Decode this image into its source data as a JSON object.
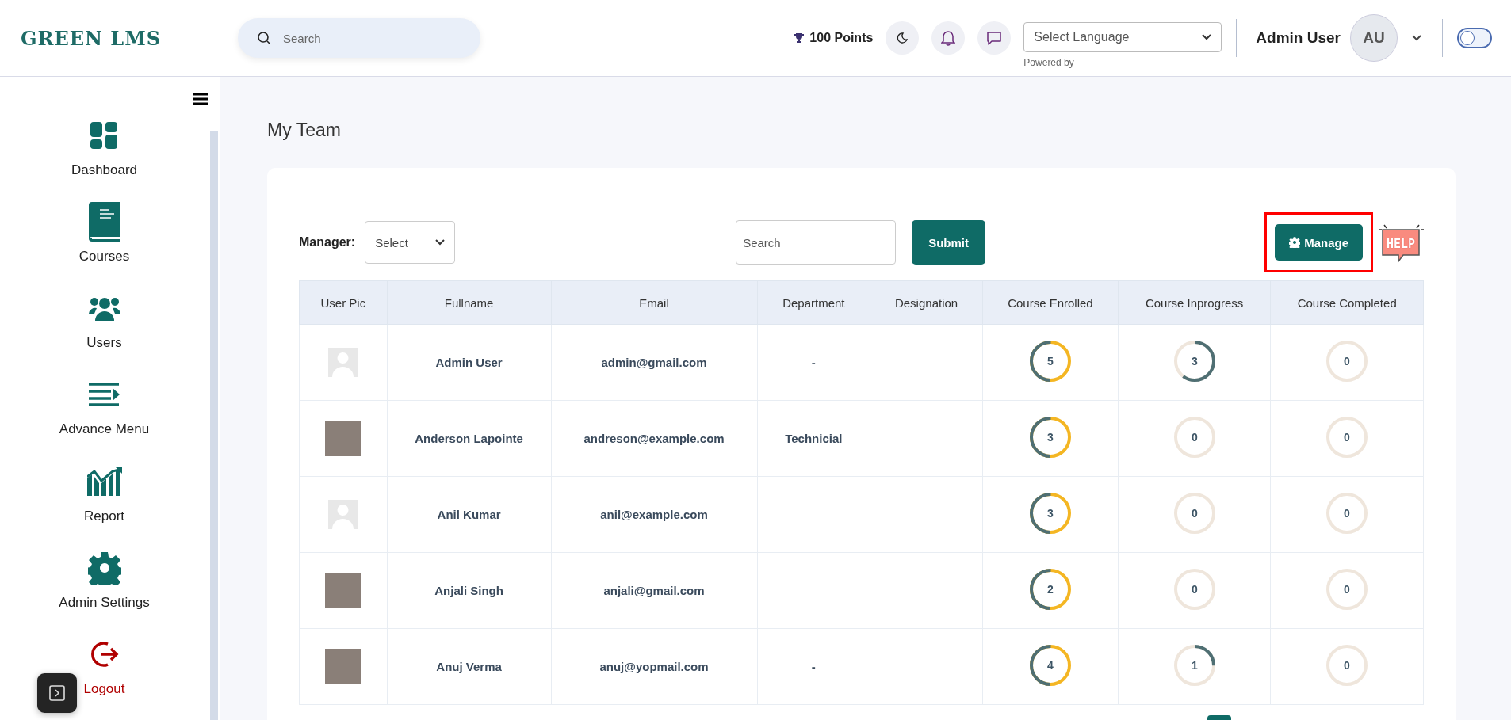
{
  "header": {
    "logo": "GREEN LMS",
    "search": {
      "placeholder": "Search"
    },
    "points": "100 Points",
    "language": {
      "value": "Select Language",
      "note": "Powered by"
    },
    "user": {
      "name": "Admin User",
      "initials": "AU"
    },
    "toggle": {
      "on": false
    }
  },
  "sidebar": {
    "items": [
      {
        "label": "Dashboard",
        "kind": "grid"
      },
      {
        "label": "Courses",
        "kind": "book"
      },
      {
        "label": "Users",
        "kind": "users"
      },
      {
        "label": "Advance Menu",
        "kind": "menu"
      },
      {
        "label": "Report",
        "kind": "chart"
      },
      {
        "label": "Admin Settings",
        "kind": "gear"
      },
      {
        "label": "Logout",
        "kind": "logout"
      }
    ]
  },
  "page": {
    "title": "My Team"
  },
  "filters": {
    "manager_label": "Manager:",
    "manager_select": "Select",
    "search": {
      "placeholder": "Search"
    },
    "submit": "Submit",
    "manage": "Manage",
    "help": "HELP"
  },
  "table": {
    "columns": [
      "User Pic",
      "Fullname",
      "Email",
      "Department",
      "Designation",
      "Course Enrolled",
      "Course Inprogress",
      "Course Completed"
    ],
    "rows": [
      {
        "kind": "placeholder",
        "fullname": "Admin User",
        "email": "admin@gmail.com",
        "department": "-",
        "designation": "",
        "enrolled": {
          "value": "5",
          "level": 0.5
        },
        "inprogress": {
          "value": "3",
          "level": 0.6
        },
        "completed": {
          "value": "0",
          "level": 0
        }
      },
      {
        "kind": "photo",
        "fullname": "Anderson Lapointe",
        "email": "andreson@example.com",
        "department": "Technicial",
        "designation": "",
        "enrolled": {
          "value": "3",
          "level": 0.5
        },
        "inprogress": {
          "value": "0",
          "level": 0
        },
        "completed": {
          "value": "0",
          "level": 0
        }
      },
      {
        "kind": "placeholder",
        "fullname": "Anil Kumar",
        "email": "anil@example.com",
        "department": "",
        "designation": "",
        "enrolled": {
          "value": "3",
          "level": 0.5
        },
        "inprogress": {
          "value": "0",
          "level": 0
        },
        "completed": {
          "value": "0",
          "level": 0
        }
      },
      {
        "kind": "photo",
        "fullname": "Anjali Singh",
        "email": "anjali@gmail.com",
        "department": "",
        "designation": "",
        "enrolled": {
          "value": "2",
          "level": 0.5
        },
        "inprogress": {
          "value": "0",
          "level": 0
        },
        "completed": {
          "value": "0",
          "level": 0
        }
      },
      {
        "kind": "photo",
        "fullname": "Anuj Verma",
        "email": "anuj@yopmail.com",
        "department": "-",
        "designation": "",
        "enrolled": {
          "value": "4",
          "level": 0.5
        },
        "inprogress": {
          "value": "1",
          "level": 0.25
        },
        "completed": {
          "value": "0",
          "level": 0
        }
      }
    ]
  }
}
